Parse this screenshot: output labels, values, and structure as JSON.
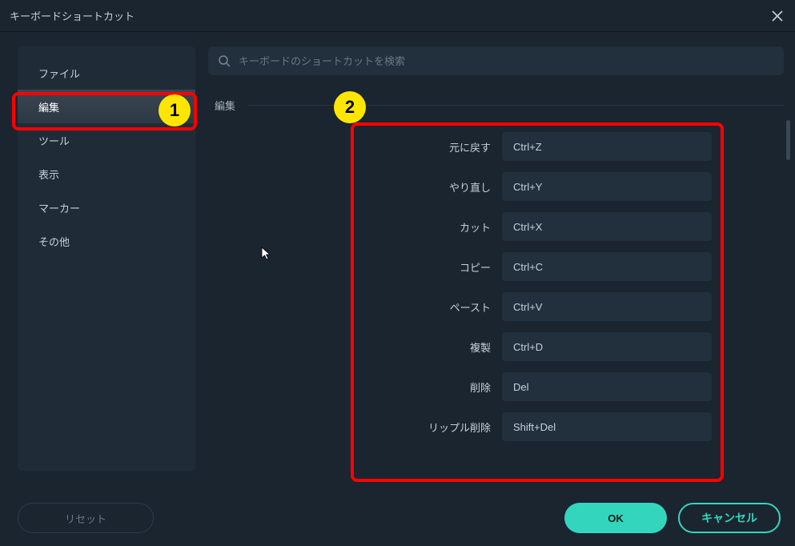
{
  "title": "キーボードショートカット",
  "search": {
    "placeholder": "キーボードのショートカットを検索"
  },
  "sidebar": {
    "items": [
      {
        "label": "ファイル",
        "selected": false
      },
      {
        "label": "編集",
        "selected": true
      },
      {
        "label": "ツール",
        "selected": false
      },
      {
        "label": "表示",
        "selected": false
      },
      {
        "label": "マーカー",
        "selected": false
      },
      {
        "label": "その他",
        "selected": false
      }
    ]
  },
  "section": {
    "heading": "編集"
  },
  "shortcuts": [
    {
      "label": "元に戻す",
      "value": "Ctrl+Z"
    },
    {
      "label": "やり直し",
      "value": "Ctrl+Y"
    },
    {
      "label": "カット",
      "value": "Ctrl+X"
    },
    {
      "label": "コピー",
      "value": "Ctrl+C"
    },
    {
      "label": "ペースト",
      "value": "Ctrl+V"
    },
    {
      "label": "複製",
      "value": "Ctrl+D"
    },
    {
      "label": "削除",
      "value": "Del"
    },
    {
      "label": "リップル削除",
      "value": "Shift+Del"
    }
  ],
  "footer": {
    "reset": "リセット",
    "ok": "OK",
    "cancel": "キャンセル"
  },
  "annotations": {
    "badge1": "1",
    "badge2": "2"
  }
}
